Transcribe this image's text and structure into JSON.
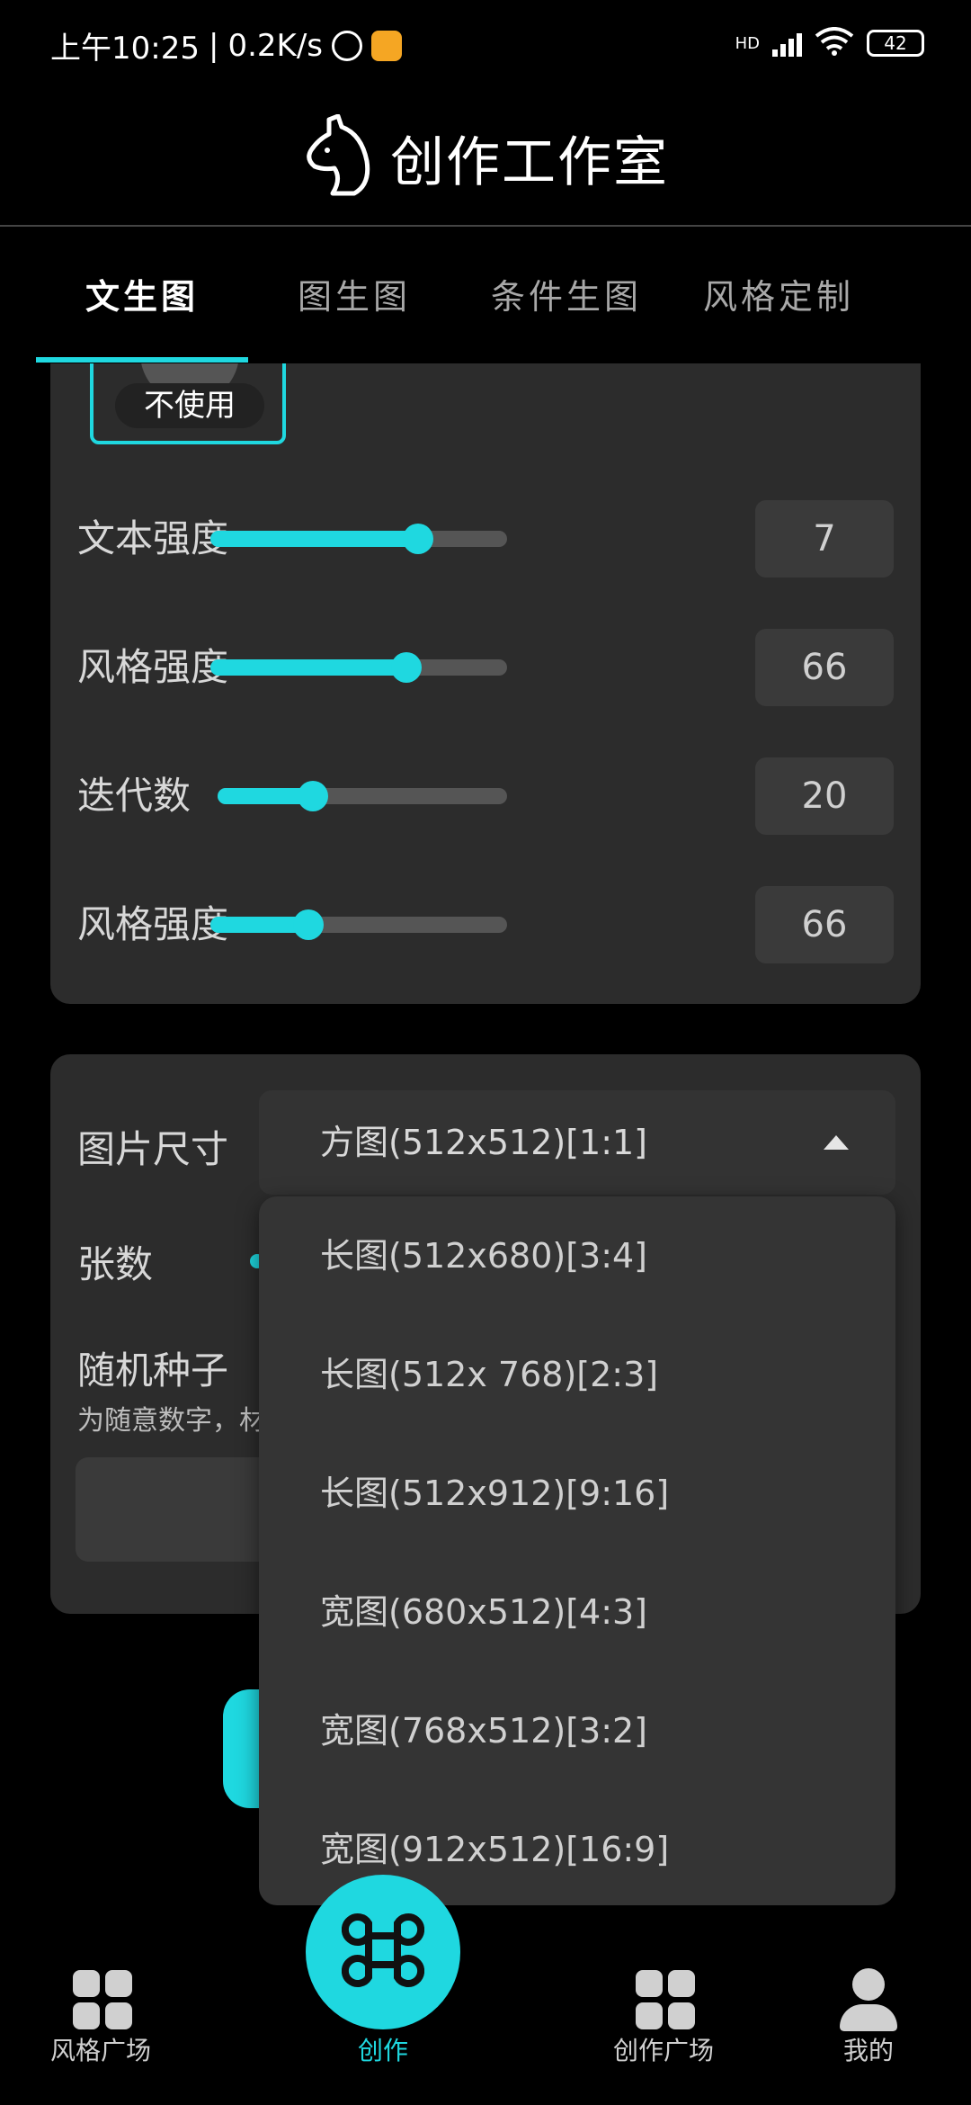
{
  "status_bar": {
    "time": "上午10:25",
    "separator": "|",
    "net_speed": "0.2K/s",
    "network_type": "HD",
    "battery": "42"
  },
  "header": {
    "title": "创作工作室",
    "logo_icon": "horse-head-icon"
  },
  "tabs": [
    {
      "label": "文生图",
      "active": true
    },
    {
      "label": "图生图",
      "active": false
    },
    {
      "label": "条件生图",
      "active": false
    },
    {
      "label": "风格定制",
      "active": false
    }
  ],
  "style_option": {
    "label": "不使用"
  },
  "sliders": [
    {
      "label": "文本强度",
      "value": "7",
      "fraction": 0.7
    },
    {
      "label": "风格强度",
      "value": "66",
      "fraction": 0.66
    },
    {
      "label": "迭代数",
      "value": "20",
      "fraction": 0.33
    },
    {
      "label": "风格强度",
      "value": "66",
      "fraction": 0.33
    }
  ],
  "image_options": {
    "size_label": "图片尺寸",
    "size_selected": "方图(512x512)[1:1]",
    "count_label": "张数",
    "seed_label": "随机种子",
    "seed_hint": "为随意数字，材"
  },
  "size_dropdown": {
    "options": [
      "长图(512x680)[3:4]",
      "长图(512x 768)[2:3]",
      "长图(512x912)[9:16]",
      "宽图(680x512)[4:3]",
      "宽图(768x512)[3:2]",
      "宽图(912x512)[16:9]"
    ]
  },
  "bottom_nav": {
    "items": [
      {
        "label": "风格广场",
        "icon": "grid-icon",
        "active": false
      },
      {
        "label": "创作",
        "icon": "command-icon",
        "active": true
      },
      {
        "label": "创作广场",
        "icon": "grid-icon",
        "active": false
      },
      {
        "label": "我的",
        "icon": "person-icon",
        "active": false
      }
    ]
  },
  "colors": {
    "accent": "#1fd8e0",
    "background": "#000000",
    "panel": "#2c2c2c"
  }
}
